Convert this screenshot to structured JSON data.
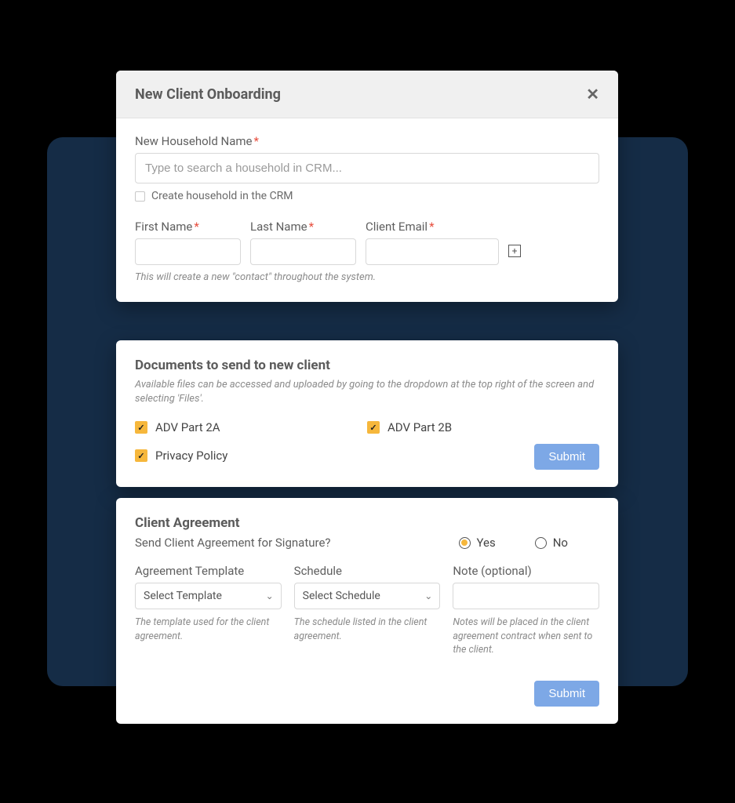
{
  "modal": {
    "title": "New Client Onboarding",
    "household_label": "New Household Name",
    "household_placeholder": "Type to search a household in CRM...",
    "create_household_label": "Create household in the CRM",
    "first_name_label": "First Name",
    "last_name_label": "Last Name",
    "client_email_label": "Client Email",
    "contact_help": "This will create a new \"contact\" throughout the system."
  },
  "documents": {
    "title": "Documents to send to new client",
    "help": "Available files can be accessed and uploaded by going to the dropdown at the top right of the screen and selecting 'Files'.",
    "items": [
      "ADV Part 2A",
      "ADV Part 2B",
      "Privacy Policy"
    ],
    "submit_label": "Submit"
  },
  "agreement": {
    "title": "Client Agreement",
    "question": "Send Client Agreement for Signature?",
    "yes_label": "Yes",
    "no_label": "No",
    "template_label": "Agreement Template",
    "template_placeholder": "Select Template",
    "template_help": "The template used for the client agreement.",
    "schedule_label": "Schedule",
    "schedule_placeholder": "Select Schedule",
    "schedule_help": "The schedule listed in the client agreement.",
    "note_label": "Note (optional)",
    "note_help": "Notes will be placed in the client agreement contract when sent to the client.",
    "submit_label": "Submit"
  }
}
